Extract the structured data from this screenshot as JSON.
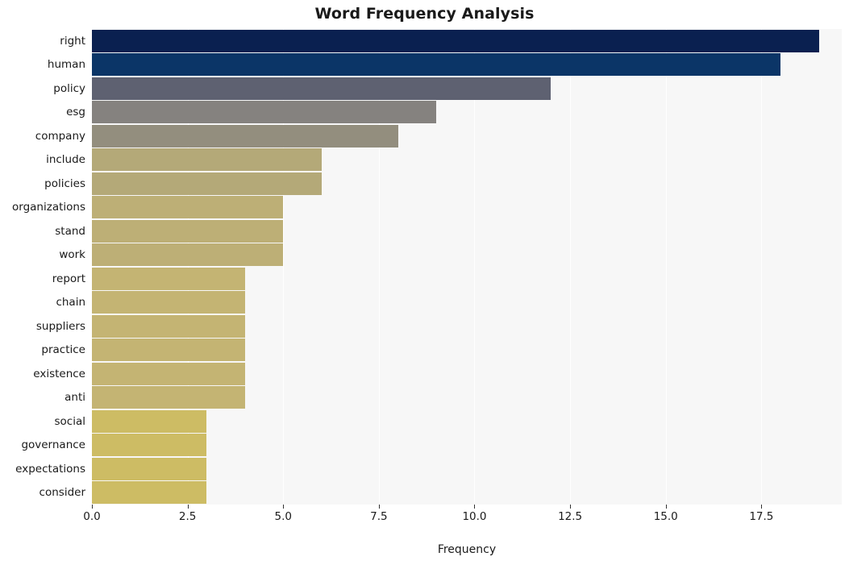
{
  "chart_data": {
    "type": "bar",
    "orientation": "horizontal",
    "title": "Word Frequency Analysis",
    "xlabel": "Frequency",
    "ylabel": "",
    "xlim": [
      0,
      19.6
    ],
    "grid": true,
    "legend": false,
    "categories": [
      "right",
      "human",
      "policy",
      "esg",
      "company",
      "include",
      "policies",
      "organizations",
      "stand",
      "work",
      "report",
      "chain",
      "suppliers",
      "practice",
      "existence",
      "anti",
      "social",
      "governance",
      "expectations",
      "consider"
    ],
    "values": [
      19,
      18,
      12,
      9,
      8,
      6,
      6,
      5,
      5,
      5,
      4,
      4,
      4,
      4,
      4,
      4,
      3,
      3,
      3,
      3
    ],
    "bar_colors": [
      "#0a2050",
      "#0b3567",
      "#5e6171",
      "#85827f",
      "#938e7e",
      "#b4a978",
      "#b4a978",
      "#bdaf76",
      "#bdaf76",
      "#bdaf76",
      "#c4b473",
      "#c4b473",
      "#c4b473",
      "#c4b473",
      "#c4b473",
      "#c4b473",
      "#cdbc64",
      "#cdbc64",
      "#cdbc64",
      "#cdbc64"
    ],
    "xticks": [
      0.0,
      2.5,
      5.0,
      7.5,
      10.0,
      12.5,
      15.0,
      17.5
    ],
    "xticklabels": [
      "0.0",
      "2.5",
      "5.0",
      "7.5",
      "10.0",
      "12.5",
      "15.0",
      "17.5"
    ],
    "plot_background": "#f7f7f7",
    "figure_background": "#ffffff",
    "gridline_color": "#ffffff"
  }
}
